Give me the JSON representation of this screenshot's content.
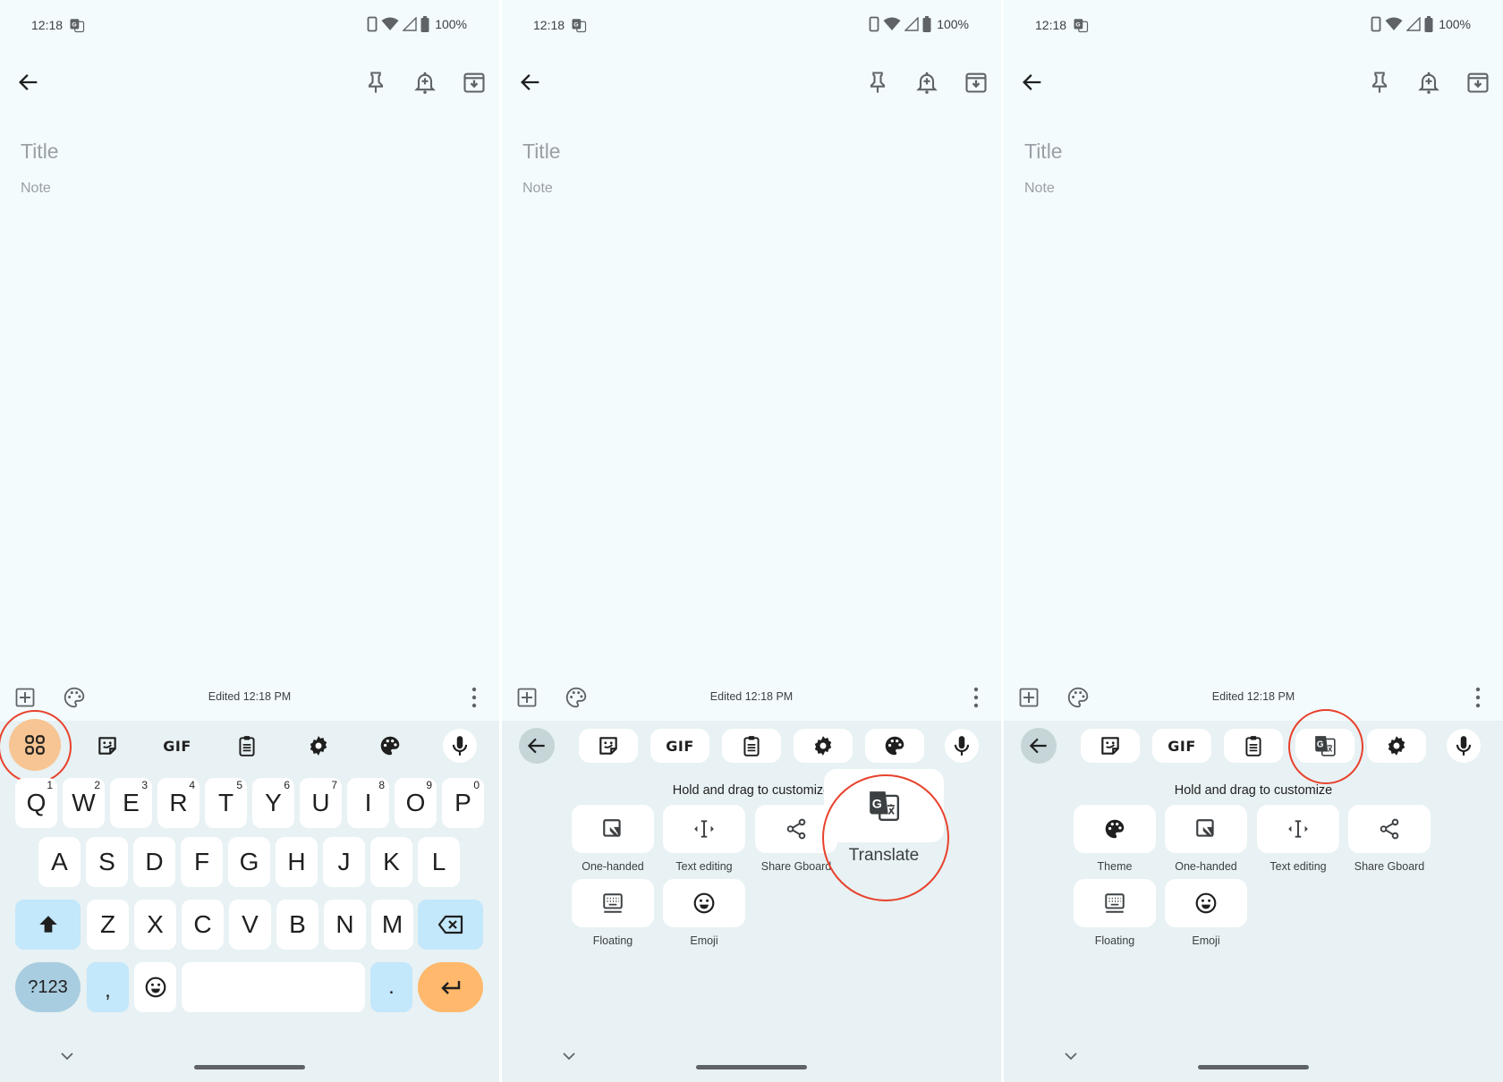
{
  "status_bar": {
    "time": "12:18",
    "battery": "100%"
  },
  "note": {
    "title_placeholder": "Title",
    "note_placeholder": "Note",
    "edited": "Edited 12:18 PM"
  },
  "icons": {
    "back": "arrow-left-icon",
    "pin": "pin-icon",
    "reminder": "bell-plus-icon",
    "archive": "archive-icon",
    "add": "add-box-icon",
    "palette": "palette-outline-icon",
    "more": "more-vert-icon"
  },
  "keyboard": {
    "toolbar_panel1": [
      "apps-menu",
      "sticker",
      "GIF",
      "clipboard",
      "settings",
      "theme",
      "voice"
    ],
    "gif_label": "GIF",
    "rows": [
      [
        {
          "k": "Q",
          "h": "1"
        },
        {
          "k": "W",
          "h": "2"
        },
        {
          "k": "E",
          "h": "3"
        },
        {
          "k": "R",
          "h": "4"
        },
        {
          "k": "T",
          "h": "5"
        },
        {
          "k": "Y",
          "h": "6"
        },
        {
          "k": "U",
          "h": "7"
        },
        {
          "k": "I",
          "h": "8"
        },
        {
          "k": "O",
          "h": "9"
        },
        {
          "k": "P",
          "h": "0"
        }
      ],
      [
        {
          "k": "A"
        },
        {
          "k": "S"
        },
        {
          "k": "D"
        },
        {
          "k": "F"
        },
        {
          "k": "G"
        },
        {
          "k": "H"
        },
        {
          "k": "J"
        },
        {
          "k": "K"
        },
        {
          "k": "L"
        }
      ],
      [
        {
          "k": "Z"
        },
        {
          "k": "X"
        },
        {
          "k": "C"
        },
        {
          "k": "V"
        },
        {
          "k": "B"
        },
        {
          "k": "N"
        },
        {
          "k": "M"
        }
      ]
    ],
    "symbols_label": "?123",
    "comma": ",",
    "period": "."
  },
  "menu_panel2": {
    "hint": "Hold and drag to customize",
    "toolbar": [
      "back",
      "sticker",
      "GIF",
      "clipboard",
      "settings",
      "theme",
      "voice"
    ],
    "tiles": [
      {
        "label": "One-handed",
        "icon": "one-handed-icon"
      },
      {
        "label": "Text editing",
        "icon": "text-editing-icon"
      },
      {
        "label": "Share Gboard",
        "icon": "share-icon"
      },
      {
        "label": "Floating",
        "icon": "floating-keyboard-icon"
      },
      {
        "label": "Emoji",
        "icon": "emoji-icon"
      }
    ],
    "dragging": {
      "label": "Translate",
      "icon": "translate-icon"
    }
  },
  "menu_panel3": {
    "hint": "Hold and drag to customize",
    "toolbar": [
      "back",
      "sticker",
      "GIF",
      "clipboard",
      "translate",
      "settings",
      "voice"
    ],
    "tiles": [
      {
        "label": "Theme",
        "icon": "palette-icon"
      },
      {
        "label": "One-handed",
        "icon": "one-handed-icon"
      },
      {
        "label": "Text editing",
        "icon": "text-editing-icon"
      },
      {
        "label": "Share Gboard",
        "icon": "share-icon"
      },
      {
        "label": "Floating",
        "icon": "floating-keyboard-icon"
      },
      {
        "label": "Emoji",
        "icon": "emoji-icon"
      }
    ]
  },
  "colors": {
    "highlight_ring": "#e8412c",
    "menu_button": "#f7c593",
    "enter_key": "#ffb86c",
    "modifier_key": "#c3e7fb",
    "symbols_key": "#a8cde0",
    "keyboard_bg": "#e8f1f3",
    "note_bg": "#f3fbfd"
  }
}
